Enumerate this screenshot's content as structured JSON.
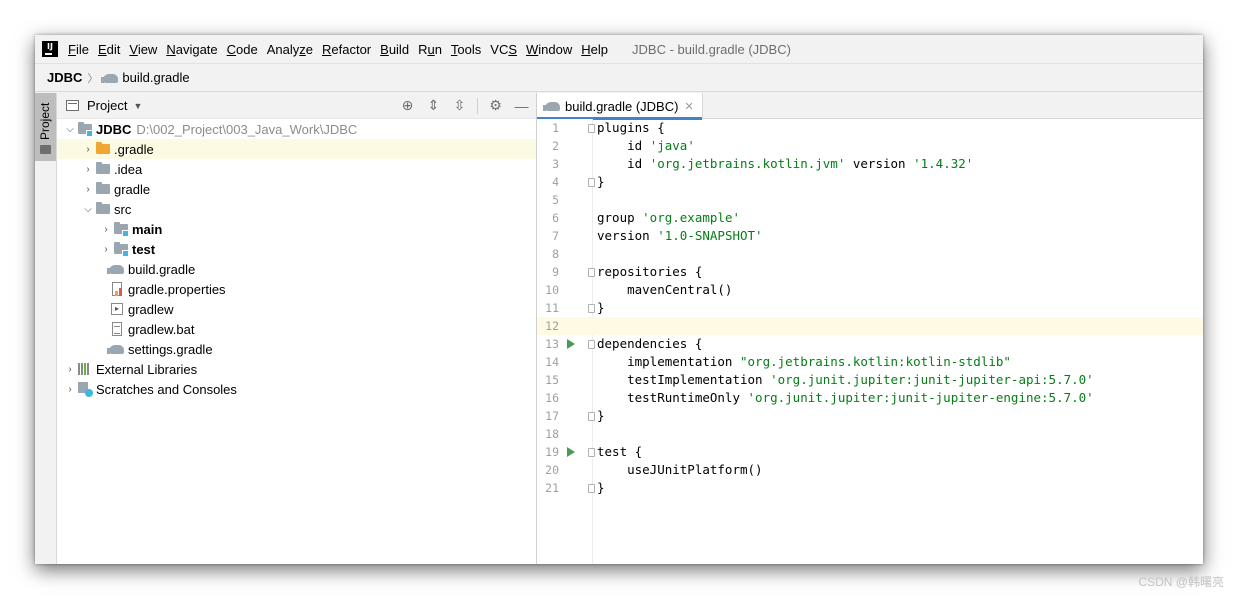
{
  "app": {
    "logo_text": "IJ",
    "window_title": "JDBC - build.gradle (JDBC)"
  },
  "menu": [
    {
      "first": "F",
      "rest": "ile"
    },
    {
      "first": "E",
      "rest": "dit"
    },
    {
      "first": "V",
      "rest": "iew"
    },
    {
      "first": "N",
      "rest": "avigate"
    },
    {
      "first": "C",
      "rest": "ode"
    },
    {
      "first": "",
      "rest": "Analyze",
      "plain": true
    },
    {
      "first": "R",
      "rest": "efactor"
    },
    {
      "first": "B",
      "rest": "uild"
    },
    {
      "first": "R",
      "rest": "un",
      "pre": ""
    },
    {
      "first": "T",
      "rest": "ools"
    },
    {
      "first": "S",
      "rest": "",
      "pre": "VC"
    },
    {
      "first": "W",
      "rest": "indow"
    },
    {
      "first": "H",
      "rest": "elp"
    }
  ],
  "breadcrumb": {
    "root": "JDBC",
    "file": "build.gradle"
  },
  "toolstrip": {
    "project_tab": "Project"
  },
  "project_panel": {
    "title": "Project",
    "tree": {
      "root_label": "JDBC",
      "root_path": "D:\\002_Project\\003_Java_Work\\JDBC",
      "gradle_dir": ".gradle",
      "idea_dir": ".idea",
      "gradle2_dir": "gradle",
      "src_dir": "src",
      "main_dir": "main",
      "test_dir": "test",
      "build_gradle": "build.gradle",
      "gradle_properties": "gradle.properties",
      "gradlew": "gradlew",
      "gradlew_bat": "gradlew.bat",
      "settings_gradle": "settings.gradle",
      "external_libraries": "External Libraries",
      "scratches": "Scratches and Consoles"
    }
  },
  "editor": {
    "tab_label": "build.gradle (JDBC)",
    "caret_line": 12,
    "lines": [
      {
        "n": "1",
        "segs": [
          [
            "plugins {",
            ""
          ]
        ],
        "fold": true
      },
      {
        "n": "2",
        "segs": [
          [
            "    id ",
            ""
          ],
          [
            "'java'",
            "str"
          ]
        ]
      },
      {
        "n": "3",
        "segs": [
          [
            "    id ",
            ""
          ],
          [
            "'org.jetbrains.kotlin.jvm'",
            "str"
          ],
          [
            " version ",
            ""
          ],
          [
            "'1.4.32'",
            "str"
          ]
        ]
      },
      {
        "n": "4",
        "segs": [
          [
            "}",
            ""
          ]
        ],
        "fold": true
      },
      {
        "n": "5",
        "segs": []
      },
      {
        "n": "6",
        "segs": [
          [
            "group ",
            ""
          ],
          [
            "'org.example'",
            "str"
          ]
        ]
      },
      {
        "n": "7",
        "segs": [
          [
            "version ",
            ""
          ],
          [
            "'1.0-SNAPSHOT'",
            "str"
          ]
        ]
      },
      {
        "n": "8",
        "segs": []
      },
      {
        "n": "9",
        "segs": [
          [
            "repositories {",
            ""
          ]
        ],
        "fold": true
      },
      {
        "n": "10",
        "segs": [
          [
            "    mavenCentral()",
            ""
          ]
        ]
      },
      {
        "n": "11",
        "segs": [
          [
            "}",
            ""
          ]
        ],
        "fold": true
      },
      {
        "n": "12",
        "segs": []
      },
      {
        "n": "13",
        "segs": [
          [
            "dependencies {",
            ""
          ]
        ],
        "fold": true,
        "run": true
      },
      {
        "n": "14",
        "segs": [
          [
            "    implementation ",
            ""
          ],
          [
            "\"org.jetbrains.kotlin:kotlin-stdlib\"",
            "str"
          ]
        ]
      },
      {
        "n": "15",
        "segs": [
          [
            "    testImplementation ",
            ""
          ],
          [
            "'org.junit.jupiter:junit-jupiter-api:5.7.0'",
            "str"
          ]
        ]
      },
      {
        "n": "16",
        "segs": [
          [
            "    testRuntimeOnly ",
            ""
          ],
          [
            "'org.junit.jupiter:junit-jupiter-engine:5.7.0'",
            "str"
          ]
        ]
      },
      {
        "n": "17",
        "segs": [
          [
            "}",
            ""
          ]
        ],
        "fold": true
      },
      {
        "n": "18",
        "segs": []
      },
      {
        "n": "19",
        "segs": [
          [
            "test {",
            ""
          ]
        ],
        "fold": true,
        "run": true
      },
      {
        "n": "20",
        "segs": [
          [
            "    useJUnitPlatform()",
            ""
          ]
        ]
      },
      {
        "n": "21",
        "segs": [
          [
            "}",
            ""
          ]
        ],
        "fold": true
      }
    ]
  },
  "watermark": "CSDN @韩曙亮"
}
